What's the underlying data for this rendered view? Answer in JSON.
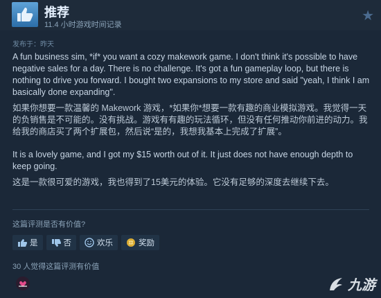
{
  "review": {
    "verdict": "推荐",
    "playtime": "11.4 小时游戏时间记录",
    "posted": "发布于：昨天",
    "paragraphs": [
      {
        "lang": "en",
        "text": "A fun business sim, *if* you want a cozy makework game. I don't think it's possible to have negative sales for a day. There is no challenge. It's got a fun gameplay loop, but there is nothing to drive you forward. I bought two expansions to my store and said \"yeah, I think I am basically done expanding\"."
      },
      {
        "lang": "cn",
        "text": "如果你想要一款温馨的 Makework 游戏，*如果你*想要一款有趣的商业模拟游戏。我觉得一天的负销售是不可能的。没有挑战。游戏有有趣的玩法循环，但没有任何推动你前进的动力。我给我的商店买了两个扩展包，然后说“是的，我想我基本上完成了扩展”。"
      },
      {
        "lang": "en",
        "text": "It is a lovely game, and I got my $15 worth out of it. It just does not have enough depth to keep going."
      },
      {
        "lang": "cn",
        "text": "这是一款很可爱的游戏，我也得到了15美元的体验。它没有足够的深度去继续下去。"
      }
    ]
  },
  "feedback": {
    "question": "这篇评测是否有价值?",
    "buttons": {
      "yes": "是",
      "no": "否",
      "funny": "欢乐",
      "award": "奖励"
    },
    "helpful_count": "30 人觉得这篇评测有价值"
  },
  "watermark": {
    "text": "九游"
  },
  "colors": {
    "background": "#1b2838",
    "accent": "#5fa3d8"
  }
}
